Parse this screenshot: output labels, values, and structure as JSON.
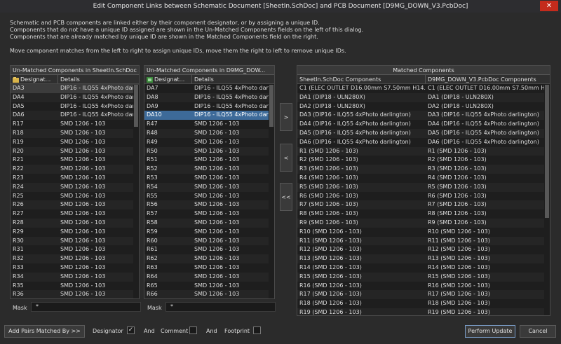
{
  "window": {
    "title": "Edit Component Links between Schematic Document [SheetIn.SchDoc] and PCB Document [D9MG_DOWN_V3.PcbDoc]",
    "close": "✕"
  },
  "info": {
    "line1": "Schematic and PCB components are linked either by their component designator, or by assigning a unique ID.",
    "line2": "Components that do not have a unique ID assigned are shown in the Un-Matched Components fields on the left of this dialog.",
    "line3": "Components that are already matched by unique ID are shown in the Matched Components field on the right.",
    "line4": "Move component matches from the left to right to assign unique IDs, move them the right to left to remove unique IDs."
  },
  "sch_panel": {
    "title": "Un-Matched Components in SheetIn.SchDoc",
    "col1": "Designat...",
    "col2": "Details",
    "rows": [
      [
        "DA3",
        "DIP16 - ILQ55 4xPhoto darli"
      ],
      [
        "DA4",
        "DIP16 - ILQ55 4xPhoto darli"
      ],
      [
        "DA5",
        "DIP16 - ILQ55 4xPhoto darli"
      ],
      [
        "DA6",
        "DIP16 - ILQ55 4xPhoto darli"
      ],
      [
        "R17",
        "SMD 1206 - 103"
      ],
      [
        "R18",
        "SMD 1206 - 103"
      ],
      [
        "R19",
        "SMD 1206 - 103"
      ],
      [
        "R20",
        "SMD 1206 - 103"
      ],
      [
        "R21",
        "SMD 1206 - 103"
      ],
      [
        "R22",
        "SMD 1206 - 103"
      ],
      [
        "R23",
        "SMD 1206 - 103"
      ],
      [
        "R24",
        "SMD 1206 - 103"
      ],
      [
        "R25",
        "SMD 1206 - 103"
      ],
      [
        "R26",
        "SMD 1206 - 103"
      ],
      [
        "R27",
        "SMD 1206 - 103"
      ],
      [
        "R28",
        "SMD 1206 - 103"
      ],
      [
        "R29",
        "SMD 1206 - 103"
      ],
      [
        "R30",
        "SMD 1206 - 103"
      ],
      [
        "R31",
        "SMD 1206 - 103"
      ],
      [
        "R32",
        "SMD 1206 - 103"
      ],
      [
        "R33",
        "SMD 1206 - 103"
      ],
      [
        "R34",
        "SMD 1206 - 103"
      ],
      [
        "R35",
        "SMD 1206 - 103"
      ],
      [
        "R36",
        "SMD 1206 - 103"
      ]
    ],
    "mask_label": "Mask",
    "mask_value": "*"
  },
  "pcb_panel": {
    "title": "Un-Matched Components in D9MG_DOW...",
    "col1": "Designat...",
    "col2": "Details",
    "rows": [
      [
        "DA7",
        "DIP16 - ILQ55 4xPhoto darli"
      ],
      [
        "DA8",
        "DIP16 - ILQ55 4xPhoto darli"
      ],
      [
        "DA9",
        "DIP16 - ILQ55 4xPhoto darli"
      ],
      [
        "DA10",
        "DIP16 - ILQ55 4xPhoto darli"
      ],
      [
        "R47",
        "SMD 1206 - 103"
      ],
      [
        "R48",
        "SMD 1206 - 103"
      ],
      [
        "R49",
        "SMD 1206 - 103"
      ],
      [
        "R50",
        "SMD 1206 - 103"
      ],
      [
        "R51",
        "SMD 1206 - 103"
      ],
      [
        "R52",
        "SMD 1206 - 103"
      ],
      [
        "R53",
        "SMD 1206 - 103"
      ],
      [
        "R54",
        "SMD 1206 - 103"
      ],
      [
        "R55",
        "SMD 1206 - 103"
      ],
      [
        "R56",
        "SMD 1206 - 103"
      ],
      [
        "R57",
        "SMD 1206 - 103"
      ],
      [
        "R58",
        "SMD 1206 - 103"
      ],
      [
        "R59",
        "SMD 1206 - 103"
      ],
      [
        "R60",
        "SMD 1206 - 103"
      ],
      [
        "R61",
        "SMD 1206 - 103"
      ],
      [
        "R62",
        "SMD 1206 - 103"
      ],
      [
        "R63",
        "SMD 1206 - 103"
      ],
      [
        "R64",
        "SMD 1206 - 103"
      ],
      [
        "R65",
        "SMD 1206 - 103"
      ],
      [
        "R66",
        "SMD 1206 - 103"
      ]
    ],
    "mask_label": "Mask",
    "mask_value": "*"
  },
  "move_buttons": {
    "right": ">",
    "left": "<",
    "all_left": "<<"
  },
  "matched_panel": {
    "title": "Matched Components",
    "col1": "SheetIn.SchDoc Components",
    "col2": "D9MG_DOWN_V3.PcbDoc Components",
    "rows": [
      [
        "C1 (ELEC OUTLET D16.00mm S7.50mm H14.00mm)",
        "C1 (ELEC OUTLET D16.00mm S7.50mm H14.00mm)"
      ],
      [
        "DA1 (DIP18 - ULN280X)",
        "DA1 (DIP18 - ULN280X)"
      ],
      [
        "DA2 (DIP18 - ULN280X)",
        "DA2 (DIP18 - ULN280X)"
      ],
      [
        "DA3 (DIP16 - ILQ55 4xPhoto darlington)",
        "DA3 (DIP16 - ILQ55 4xPhoto darlington)"
      ],
      [
        "DA4 (DIP16 - ILQ55 4xPhoto darlington)",
        "DA4 (DIP16 - ILQ55 4xPhoto darlington)"
      ],
      [
        "DA5 (DIP16 - ILQ55 4xPhoto darlington)",
        "DA5 (DIP16 - ILQ55 4xPhoto darlington)"
      ],
      [
        "DA6 (DIP16 - ILQ55 4xPhoto darlington)",
        "DA6 (DIP16 - ILQ55 4xPhoto darlington)"
      ],
      [
        "R1 (SMD 1206 - 103)",
        "R1 (SMD 1206 - 103)"
      ],
      [
        "R2 (SMD 1206 - 103)",
        "R2 (SMD 1206 - 103)"
      ],
      [
        "R3 (SMD 1206 - 103)",
        "R3 (SMD 1206 - 103)"
      ],
      [
        "R4 (SMD 1206 - 103)",
        "R4 (SMD 1206 - 103)"
      ],
      [
        "R5 (SMD 1206 - 103)",
        "R5 (SMD 1206 - 103)"
      ],
      [
        "R6 (SMD 1206 - 103)",
        "R6 (SMD 1206 - 103)"
      ],
      [
        "R7 (SMD 1206 - 103)",
        "R7 (SMD 1206 - 103)"
      ],
      [
        "R8 (SMD 1206 - 103)",
        "R8 (SMD 1206 - 103)"
      ],
      [
        "R9 (SMD 1206 - 103)",
        "R9 (SMD 1206 - 103)"
      ],
      [
        "R10 (SMD 1206 - 103)",
        "R10 (SMD 1206 - 103)"
      ],
      [
        "R11 (SMD 1206 - 103)",
        "R11 (SMD 1206 - 103)"
      ],
      [
        "R12 (SMD 1206 - 103)",
        "R12 (SMD 1206 - 103)"
      ],
      [
        "R13 (SMD 1206 - 103)",
        "R13 (SMD 1206 - 103)"
      ],
      [
        "R14 (SMD 1206 - 103)",
        "R14 (SMD 1206 - 103)"
      ],
      [
        "R15 (SMD 1206 - 103)",
        "R15 (SMD 1206 - 103)"
      ],
      [
        "R16 (SMD 1206 - 103)",
        "R16 (SMD 1206 - 103)"
      ],
      [
        "R17 (SMD 1206 - 103)",
        "R17 (SMD 1206 - 103)"
      ],
      [
        "R18 (SMD 1206 - 103)",
        "R18 (SMD 1206 - 103)"
      ],
      [
        "R19 (SMD 1206 - 103)",
        "R19 (SMD 1206 - 103)"
      ]
    ]
  },
  "footer": {
    "add_pairs": "Add Pairs Matched By >>",
    "designator": "Designator",
    "designator_checked": "✓",
    "and1": "And",
    "comment": "Comment",
    "and2": "And",
    "footprint": "Footprint",
    "perform_update": "Perform Update",
    "cancel": "Cancel"
  },
  "colors": {
    "selection": "#3d6a99",
    "close": "#c42b1c"
  },
  "icons": {
    "sch_header": "schematic-doc-icon",
    "pcb_header": "pcb-doc-icon"
  }
}
